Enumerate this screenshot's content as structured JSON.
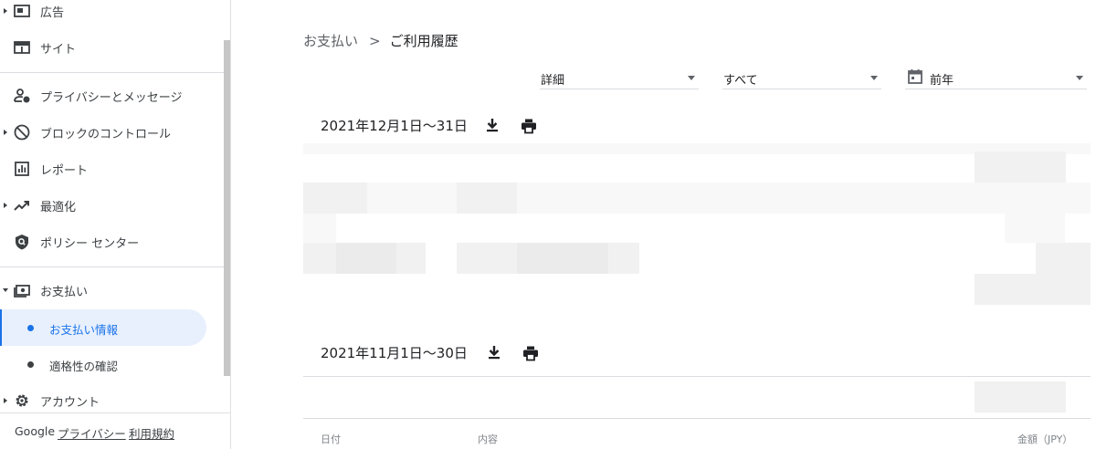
{
  "sidebar": {
    "items": [
      {
        "label": "広告",
        "icon": "ads-icon",
        "expandable": true
      },
      {
        "label": "サイト",
        "icon": "site-icon",
        "expandable": false
      },
      {
        "label": "プライバシーとメッセージ",
        "icon": "privacy-icon",
        "expandable": false
      },
      {
        "label": "ブロックのコントロール",
        "icon": "block-icon",
        "expandable": true
      },
      {
        "label": "レポート",
        "icon": "report-icon",
        "expandable": false
      },
      {
        "label": "最適化",
        "icon": "trending-icon",
        "expandable": true
      },
      {
        "label": "ポリシー センター",
        "icon": "policy-icon",
        "expandable": false
      },
      {
        "label": "お支払い",
        "icon": "payments-icon",
        "expandable": true,
        "expanded": true
      },
      {
        "label": "アカウント",
        "icon": "gear-icon",
        "expandable": true
      }
    ],
    "payments_sub": [
      {
        "label": "お支払い情報",
        "active": true
      },
      {
        "label": "適格性の確認",
        "active": false
      }
    ],
    "footer": {
      "brand": "Google",
      "privacy": "プライバシー",
      "terms": "利用規約"
    }
  },
  "breadcrumb": {
    "parent": "お支払い",
    "separator": ">",
    "current": "ご利用履歴"
  },
  "filters": {
    "detail": "詳細",
    "type": "すべて",
    "range": "前年"
  },
  "periods": [
    {
      "label": "2021年12月1日～31日"
    },
    {
      "label": "2021年11月1日～30日"
    }
  ],
  "table_headers": {
    "date": "日付",
    "content": "内容",
    "amount": "金額（JPY）"
  },
  "colors": {
    "accent": "#1a73e8",
    "active_bg": "#e8f0fe",
    "text": "#202124",
    "muted": "#5f6368"
  }
}
